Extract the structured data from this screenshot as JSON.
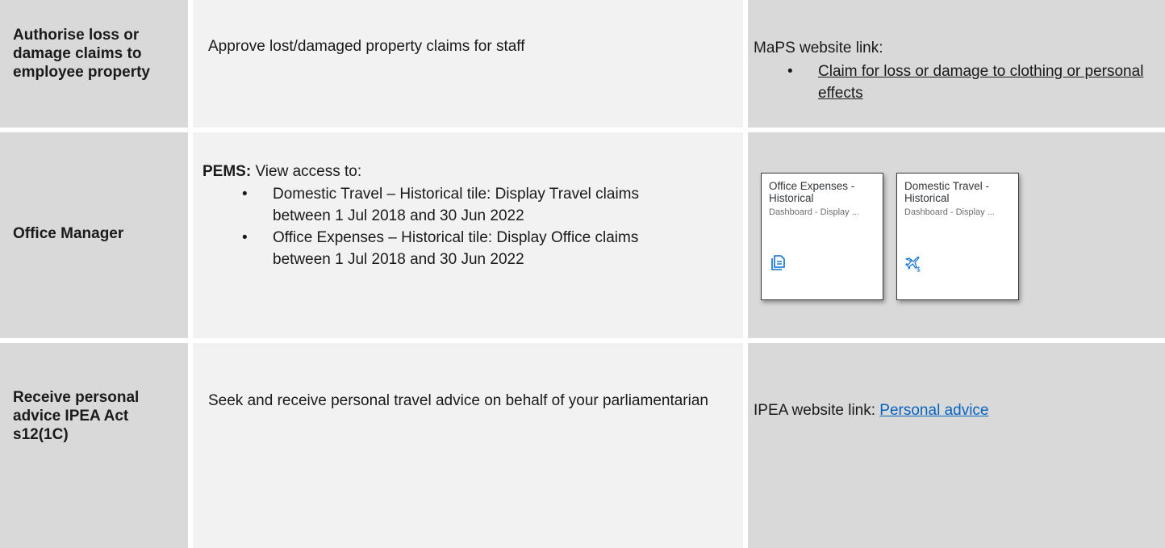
{
  "rows": [
    {
      "role": "Authorise loss or damage claims to employee property",
      "description": "Approve lost/damaged property claims for staff",
      "resource_label": "MaPS website link:",
      "resource_link": "Claim for loss or damage to clothing or personal effects"
    },
    {
      "role": "Office Manager",
      "description_prefix": "PEMS:",
      "description_intro": " View access to:",
      "bullets": [
        "Domestic Travel – Historical tile: Display Travel claims between 1 Jul 2018 and 30 Jun 2022",
        "Office Expenses – Historical tile: Display Office claims between 1 Jul 2018 and 30 Jun 2022"
      ],
      "tiles": [
        {
          "title": "Office Expenses - Historical",
          "subtitle": "Dashboard - Display ...",
          "icon": "document-icon"
        },
        {
          "title": "Domestic Travel - Historical",
          "subtitle": "Dashboard - Display ...",
          "icon": "travel-expense-icon"
        }
      ]
    },
    {
      "role": "Receive personal advice IPEA Act s12(1C)",
      "description": "Seek and receive personal travel advice on behalf of your parliamentarian",
      "resource_label": "IPEA website link: ",
      "resource_link": "Personal advice"
    }
  ],
  "colors": {
    "dark_cell": "#d9d9d9",
    "light_cell": "#f2f2f2",
    "link_blue": "#0563c1",
    "tile_icon": "#0a6ed1"
  }
}
